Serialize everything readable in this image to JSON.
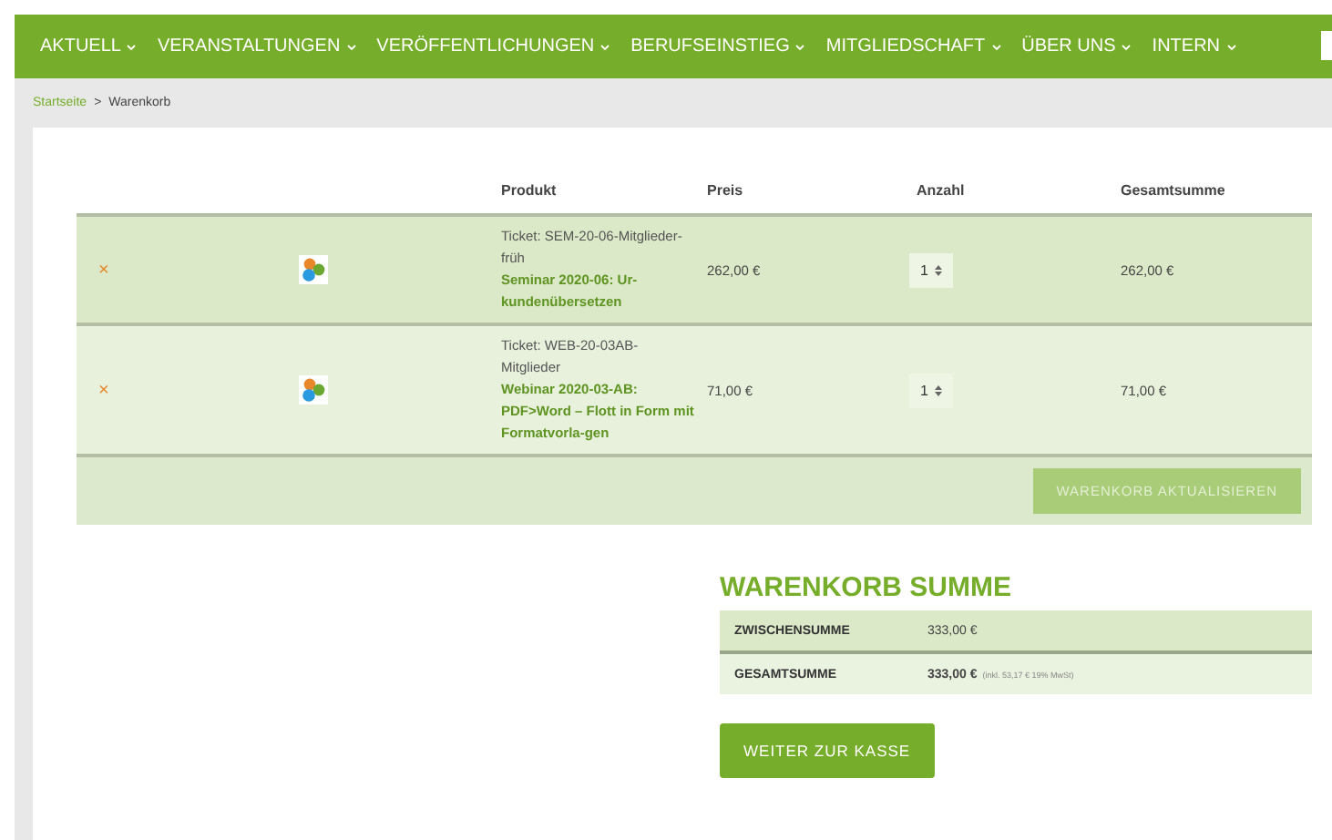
{
  "nav": {
    "items": [
      {
        "label": "AKTUELL"
      },
      {
        "label": "VERANSTALTUNGEN"
      },
      {
        "label": "VERÖFFENTLICHUNGEN"
      },
      {
        "label": "BERUFSEINSTIEG"
      },
      {
        "label": "MITGLIEDSCHAFT"
      },
      {
        "label": "ÜBER UNS"
      },
      {
        "label": "INTERN"
      }
    ]
  },
  "breadcrumb": {
    "items": [
      {
        "label": "Startseite",
        "link": true
      },
      {
        "label": "Warenkorb",
        "link": false
      }
    ],
    "separator": ">"
  },
  "cart": {
    "columns": [
      "Produkt",
      "Preis",
      "Anzahl",
      "Gesamtsumme"
    ],
    "rows": [
      {
        "remove": "×",
        "ticket": "Ticket: SEM-20-06-Mitglieder-früh",
        "product": "Seminar 2020-06: Ur-kundenübersetzen",
        "price": "262,00 €",
        "quantity": "1",
        "subtotal": "262,00 €"
      },
      {
        "remove": "×",
        "ticket": "Ticket: WEB-20-03AB-Mitglieder",
        "product": "Webinar 2020-03-AB: PDF>Word – Flott in Form mit Formatvorla-gen",
        "price": "71,00 €",
        "quantity": "1",
        "subtotal": "71,00 €"
      }
    ],
    "update_button": {
      "label": "WARENKORB AKTUALISIEREN",
      "disabled": true
    }
  },
  "totals": {
    "title": "WARENKORB SUMME",
    "rows": [
      {
        "label": "ZWISCHENSUMME",
        "value": "333,00 €"
      },
      {
        "label": "GESAMTSUMME",
        "value": "333,00 €",
        "note": "(inkl. 53,17 € 19% MwSt)"
      }
    ],
    "checkout_button": {
      "label": "WEITER ZUR KASSE"
    }
  }
}
